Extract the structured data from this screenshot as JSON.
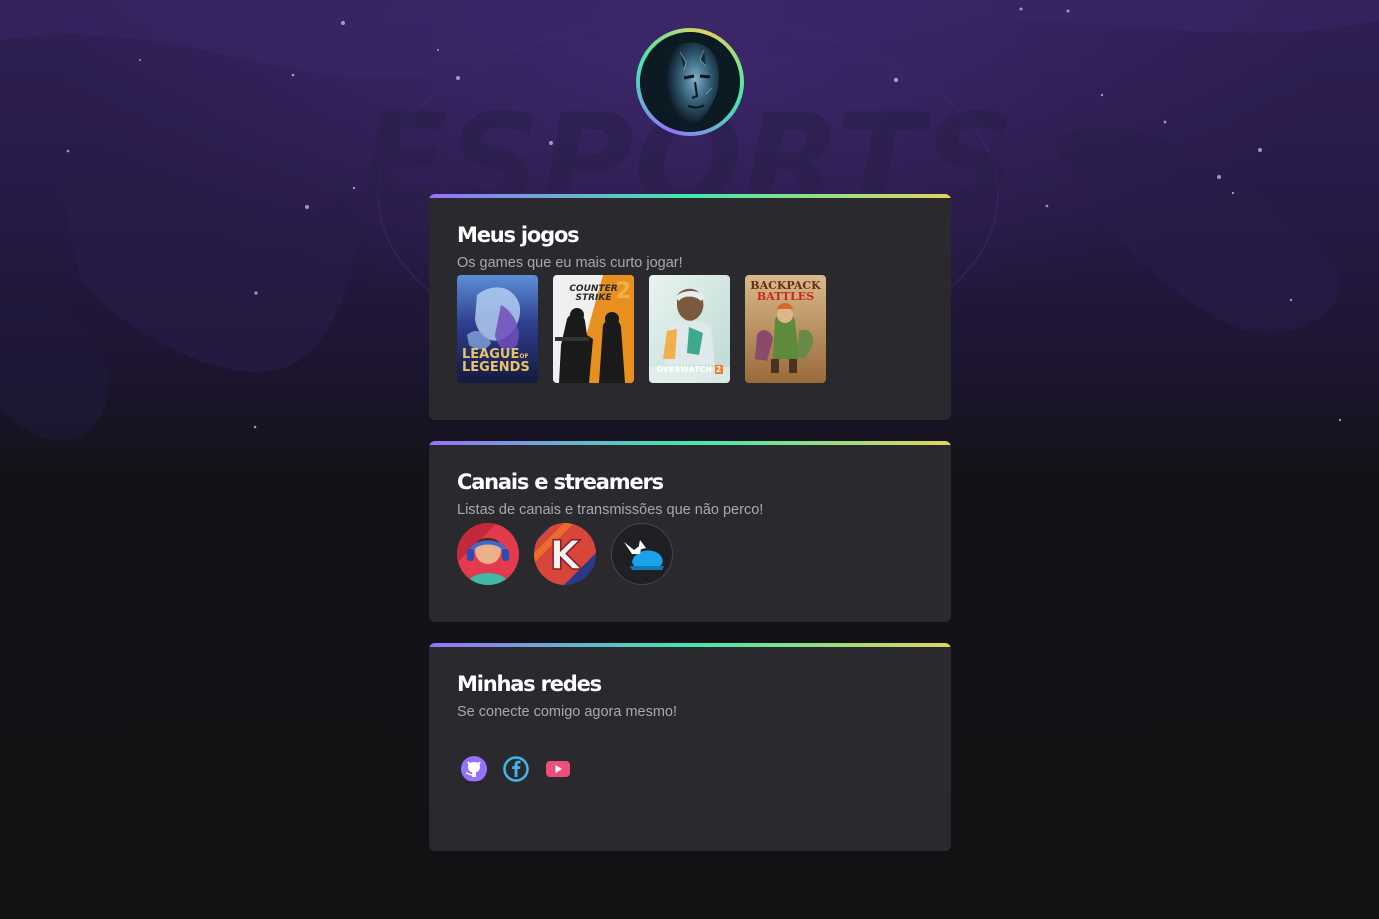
{
  "background": {
    "watermark_text": "ESPORTS"
  },
  "profile": {
    "avatar_alt": "profile-avatar"
  },
  "sections": {
    "games": {
      "title": "Meus jogos",
      "subtitle": "Os games que eu mais curto jogar!",
      "items": [
        {
          "name": "League of Legends",
          "label_line1": "LEAGUE",
          "label_line2": "LEGENDS",
          "label_of": "OF"
        },
        {
          "name": "Counter Strike 2",
          "label_line1": "COUNTER",
          "label_line2": "STRIKE",
          "label_num": "2"
        },
        {
          "name": "Overwatch 2",
          "label_line1": "OVERWATCH",
          "label_num": "2"
        },
        {
          "name": "Backpack Battles",
          "label_line1": "BACKPACK",
          "label_line2": "BATTLES"
        }
      ]
    },
    "streamers": {
      "title": "Canais e streamers",
      "subtitle": "Listas de canais e transmissões que não perco!",
      "items": [
        {
          "name": "streamer-1"
        },
        {
          "name": "streamer-2",
          "logo_letter": "K"
        },
        {
          "name": "streamer-3"
        }
      ]
    },
    "socials": {
      "title": "Minhas redes",
      "subtitle": "Se conecte comigo agora mesmo!",
      "items": [
        {
          "name": "github",
          "icon": "github-icon",
          "color": "#9572fc"
        },
        {
          "name": "facebook",
          "icon": "facebook-icon",
          "color": "#43b5e7"
        },
        {
          "name": "youtube",
          "icon": "youtube-icon",
          "color": "#ec4f7c"
        }
      ]
    }
  },
  "colors": {
    "gradient": [
      "#9572fc",
      "#43e7ad",
      "#e2d45c"
    ],
    "card_bg": "#29292e",
    "page_bg": "#121214"
  }
}
